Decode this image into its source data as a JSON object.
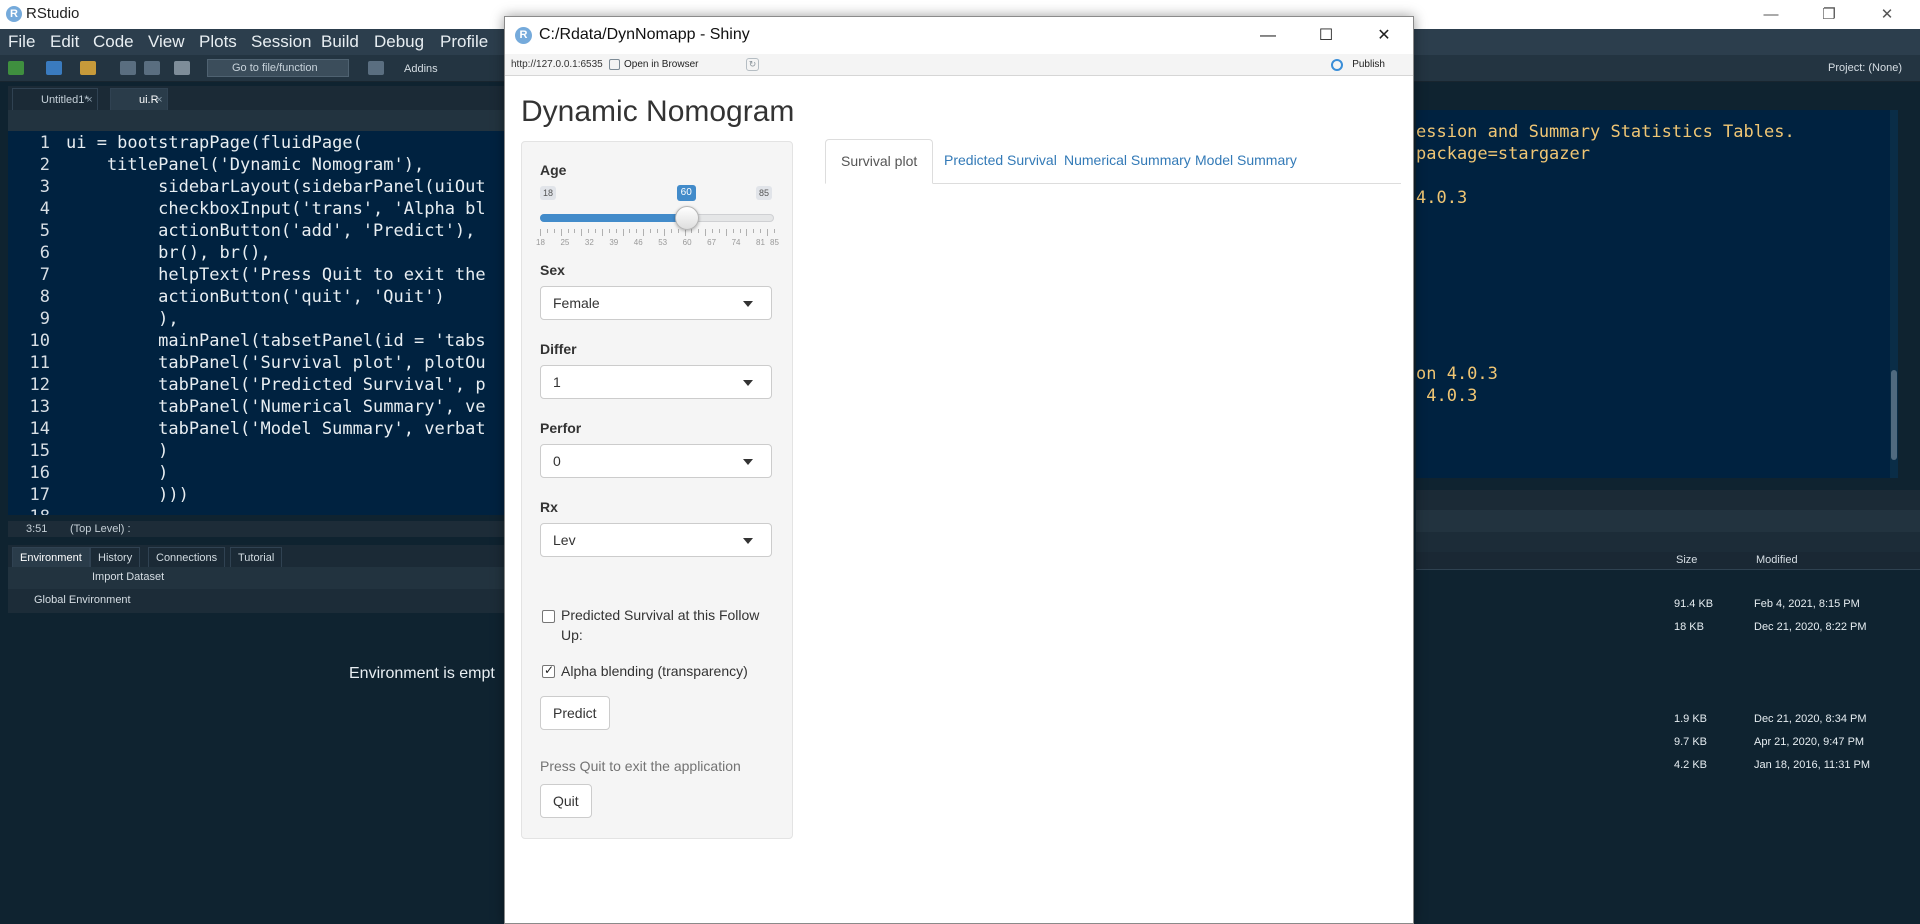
{
  "rstudio": {
    "title": "RStudio",
    "menu": [
      "File",
      "Edit",
      "Code",
      "View",
      "Plots",
      "Session",
      "Build",
      "Debug",
      "Profile"
    ],
    "toolbar": {
      "goto": "Go to file/function",
      "addins": "Addins",
      "project": "Project: (None)"
    },
    "editor": {
      "tabs": [
        {
          "label": "Untitled1*"
        },
        {
          "label": "ui.R"
        }
      ],
      "lines": [
        {
          "n": "1",
          "text": "ui = bootstrapPage(fluidPage("
        },
        {
          "n": "2",
          "text": "    titlePanel('Dynamic Nomogram'),"
        },
        {
          "n": "3",
          "text": "         sidebarLayout(sidebarPanel(uiOut"
        },
        {
          "n": "4",
          "text": "         checkboxInput('trans', 'Alpha bl"
        },
        {
          "n": "5",
          "text": "         actionButton('add', 'Predict'),"
        },
        {
          "n": "6",
          "text": "         br(), br(),"
        },
        {
          "n": "7",
          "text": "         helpText('Press Quit to exit the"
        },
        {
          "n": "8",
          "text": "         actionButton('quit', 'Quit')"
        },
        {
          "n": "9",
          "text": "         ),"
        },
        {
          "n": "10",
          "text": "         mainPanel(tabsetPanel(id = 'tabs"
        },
        {
          "n": "11",
          "text": "         tabPanel('Survival plot', plotOu"
        },
        {
          "n": "12",
          "text": "         tabPanel('Predicted Survival', p"
        },
        {
          "n": "13",
          "text": "         tabPanel('Numerical Summary', ve"
        },
        {
          "n": "14",
          "text": "         tabPanel('Model Summary', verbat"
        },
        {
          "n": "15",
          "text": "         )"
        },
        {
          "n": "16",
          "text": "         )"
        },
        {
          "n": "17",
          "text": "         )))"
        },
        {
          "n": "18",
          "text": ""
        }
      ],
      "status_pos": "3:51",
      "status_scope": "(Top Level) :"
    },
    "env": {
      "tabs": [
        "Environment",
        "History",
        "Connections",
        "Tutorial"
      ],
      "import": "Import Dataset",
      "scope": "Global Environment",
      "empty": "Environment is empt"
    },
    "console": {
      "lines": [
        "ession and Summary Statistics Tables.",
        "package=stargazer",
        "",
        "4.0.3",
        "",
        "",
        "",
        "",
        "",
        "",
        "",
        "on 4.0.3",
        " 4.0.3"
      ]
    },
    "files": {
      "headers": {
        "size": "Size",
        "modified": "Modified"
      },
      "rows": [
        {
          "size": "91.4 KB",
          "modified": "Feb 4, 2021, 8:15 PM"
        },
        {
          "size": "18 KB",
          "modified": "Dec 21, 2020, 8:22 PM"
        },
        {
          "size": "1.9 KB",
          "modified": "Dec 21, 2020, 8:34 PM"
        },
        {
          "size": "9.7 KB",
          "modified": "Apr 21, 2020, 9:47 PM"
        },
        {
          "size": "4.2 KB",
          "modified": "Jan 18, 2016, 11:31 PM"
        }
      ]
    }
  },
  "shiny": {
    "window_title": "C:/Rdata/DynNomapp - Shiny",
    "url": "http://127.0.0.1:6535",
    "open_in_browser": "Open in Browser",
    "publish": "Publish",
    "app_title": "Dynamic Nomogram",
    "age": {
      "label": "Age",
      "min": "18",
      "max": "85",
      "value": "60",
      "value_num": 60,
      "min_num": 18,
      "max_num": 85,
      "ticks": [
        "18",
        "25",
        "32",
        "39",
        "46",
        "53",
        "60",
        "67",
        "74",
        "81",
        "85"
      ]
    },
    "sex": {
      "label": "Sex",
      "value": "Female"
    },
    "differ": {
      "label": "Differ",
      "value": "1"
    },
    "perfor": {
      "label": "Perfor",
      "value": "0"
    },
    "rx": {
      "label": "Rx",
      "value": "Lev"
    },
    "check_predicted": {
      "label": "Predicted Survival at this Follow Up:",
      "checked": false
    },
    "check_alpha": {
      "label": "Alpha blending (transparency)",
      "checked": true
    },
    "predict_button": "Predict",
    "help_text": "Press Quit to exit the application",
    "quit_button": "Quit",
    "tabs": [
      {
        "label": "Survival plot",
        "active": true
      },
      {
        "label": "Predicted Survival",
        "active": false
      },
      {
        "label": "Numerical Summary",
        "active": false
      },
      {
        "label": "Model Summary",
        "active": false
      }
    ],
    "colors": {
      "accent": "#428bca",
      "link": "#337ab7"
    }
  }
}
